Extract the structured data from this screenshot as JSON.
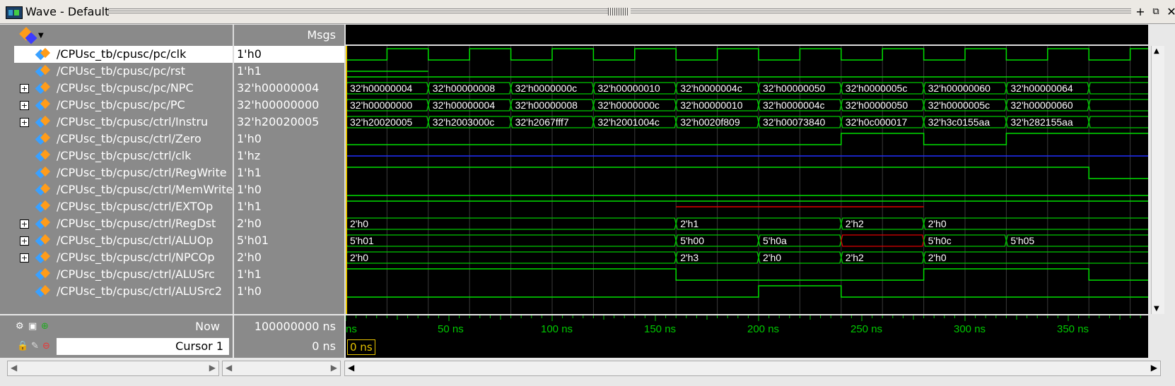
{
  "window": {
    "title": "Wave - Default"
  },
  "header": {
    "msgs_label": "Msgs"
  },
  "signals": [
    {
      "name": "/CPUsc_tb/cpusc/pc/clk",
      "value": "1'h0",
      "expandable": false,
      "selected": true
    },
    {
      "name": "/CPUsc_tb/cpusc/pc/rst",
      "value": "1'h1",
      "expandable": false
    },
    {
      "name": "/CPUsc_tb/cpusc/pc/NPC",
      "value": "32'h00000004",
      "expandable": true
    },
    {
      "name": "/CPUsc_tb/cpusc/pc/PC",
      "value": "32'h00000000",
      "expandable": true
    },
    {
      "name": "/CPUsc_tb/cpusc/ctrl/Instru",
      "value": "32'h20020005",
      "expandable": true
    },
    {
      "name": "/CPUsc_tb/cpusc/ctrl/Zero",
      "value": "1'h0",
      "expandable": false
    },
    {
      "name": "/CPUsc_tb/cpusc/ctrl/clk",
      "value": "1'hz",
      "expandable": false
    },
    {
      "name": "/CPUsc_tb/cpusc/ctrl/RegWrite",
      "value": "1'h1",
      "expandable": false
    },
    {
      "name": "/CPUsc_tb/cpusc/ctrl/MemWrite",
      "value": "1'h0",
      "expandable": false
    },
    {
      "name": "/CPUsc_tb/cpusc/ctrl/EXTOp",
      "value": "1'h1",
      "expandable": false
    },
    {
      "name": "/CPUsc_tb/cpusc/ctrl/RegDst",
      "value": "2'h0",
      "expandable": true
    },
    {
      "name": "/CPUsc_tb/cpusc/ctrl/ALUOp",
      "value": "5'h01",
      "expandable": true
    },
    {
      "name": "/CPUsc_tb/cpusc/ctrl/NPCOp",
      "value": "2'h0",
      "expandable": true
    },
    {
      "name": "/CPUsc_tb/cpusc/ctrl/ALUSrc",
      "value": "1'h1",
      "expandable": false
    },
    {
      "name": "/CPUsc_tb/cpusc/ctrl/ALUSrc2",
      "value": "1'h0",
      "expandable": false
    }
  ],
  "bus_values": {
    "NPC": [
      "32'h00000004",
      "32'h00000008",
      "32'h0000000c",
      "32'h00000010",
      "32'h0000004c",
      "32'h00000050",
      "32'h0000005c",
      "32'h00000060",
      "32'h00000064"
    ],
    "PC": [
      "32'h00000000",
      "32'h00000004",
      "32'h00000008",
      "32'h0000000c",
      "32'h00000010",
      "32'h0000004c",
      "32'h00000050",
      "32'h0000005c",
      "32'h00000060"
    ],
    "Instru": [
      "32'h20020005",
      "32'h2003000c",
      "32'h2067fff7",
      "32'h2001004c",
      "32'h0020f809",
      "32'h00073840",
      "32'h0c000017",
      "32'h3c0155aa",
      "32'h282155aa"
    ],
    "RegDst": [
      "2'h0",
      "2'h1",
      "2'h2",
      "2'h0"
    ],
    "ALUOp": [
      "5'h01",
      "5'h00",
      "5'h0a",
      "5'h0c",
      "5'h05"
    ],
    "NPCOp": [
      "2'h0",
      "2'h3",
      "2'h0",
      "2'h2",
      "2'h0"
    ]
  },
  "timeline": {
    "ticks": [
      "ns",
      "50 ns",
      "100 ns",
      "150 ns",
      "200 ns",
      "250 ns",
      "300 ns",
      "350 ns"
    ]
  },
  "status": {
    "now_label": "Now",
    "now_value": "100000000 ns",
    "cursor_label": "Cursor 1",
    "cursor_value": "0 ns",
    "cursor_marker": "0 ns"
  },
  "colors": {
    "wave_green": "#00e000",
    "bus_green": "#00c800",
    "clk_blue": "#2030ff",
    "undefined_red": "#e00000",
    "cursor_yellow": "#e8c400"
  }
}
